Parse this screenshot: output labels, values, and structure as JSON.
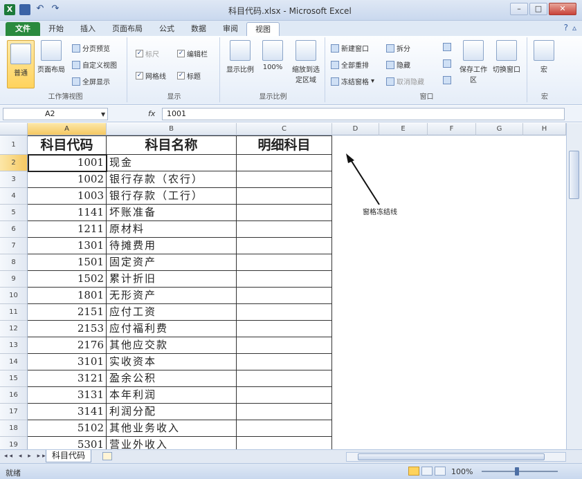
{
  "window": {
    "title": "科目代码.xlsx - Microsoft Excel",
    "buttons": [
      "–",
      "□",
      "✕"
    ]
  },
  "tabs": {
    "file": "文件",
    "items": [
      "开始",
      "插入",
      "页面布局",
      "公式",
      "数据",
      "审阅",
      "视图"
    ],
    "active": "视图"
  },
  "ribbon": {
    "views_group": {
      "label": "工作簿视图",
      "normal": "普通",
      "page_layout": "页面布局",
      "page_break": "分页预览",
      "custom_views": "自定义视图",
      "full_screen": "全屏显示"
    },
    "show_group": {
      "label": "显示",
      "ruler": "标尺",
      "formula_bar": "编辑栏",
      "gridlines": "网格线",
      "headings": "标题"
    },
    "zoom_group": {
      "label": "显示比例",
      "zoom": "显示比例",
      "zoom100": "100%",
      "zoom_selection": "缩放到选定区域"
    },
    "window_group": {
      "label": "窗口",
      "new_window": "新建窗口",
      "arrange_all": "全部重排",
      "freeze_panes": "冻结窗格",
      "split": "拆分",
      "hide": "隐藏",
      "unhide": "取消隐藏",
      "save_workspace": "保存工作区",
      "switch_windows": "切换窗口"
    },
    "macro_group": {
      "label": "宏",
      "macros": "宏"
    }
  },
  "formula_bar": {
    "name_box": "A2",
    "fx": "fx",
    "value": "1001"
  },
  "sheet": {
    "columns": [
      "A",
      "B",
      "C",
      "D",
      "E",
      "F",
      "G",
      "H"
    ],
    "headers": [
      "科目代码",
      "科目名称",
      "明细科目"
    ],
    "rows": [
      {
        "num": "1"
      },
      {
        "num": "2",
        "code": "1001",
        "name": "现金"
      },
      {
        "num": "3",
        "code": "1002",
        "name": "银行存款（农行）"
      },
      {
        "num": "4",
        "code": "1003",
        "name": "银行存款（工行）"
      },
      {
        "num": "5",
        "code": "1141",
        "name": "坏账准备"
      },
      {
        "num": "6",
        "code": "1211",
        "name": "原材料"
      },
      {
        "num": "7",
        "code": "1301",
        "name": "待摊费用"
      },
      {
        "num": "8",
        "code": "1501",
        "name": "固定资产"
      },
      {
        "num": "9",
        "code": "1502",
        "name": "累计折旧"
      },
      {
        "num": "10",
        "code": "1801",
        "name": "无形资产"
      },
      {
        "num": "11",
        "code": "2151",
        "name": "应付工资"
      },
      {
        "num": "12",
        "code": "2153",
        "name": "应付福利费"
      },
      {
        "num": "13",
        "code": "2176",
        "name": "其他应交款"
      },
      {
        "num": "14",
        "code": "3101",
        "name": "实收资本"
      },
      {
        "num": "15",
        "code": "3121",
        "name": "盈余公积"
      },
      {
        "num": "16",
        "code": "3131",
        "name": "本年利润"
      },
      {
        "num": "17",
        "code": "3141",
        "name": "利润分配"
      },
      {
        "num": "18",
        "code": "5102",
        "name": "其他业务收入"
      },
      {
        "num": "19",
        "code": "5301",
        "name": "营业外收入"
      }
    ],
    "note": "窗格冻结线"
  },
  "sheet_tabs": {
    "active": "科目代码"
  },
  "status": {
    "ready": "就绪",
    "zoom": "100%"
  }
}
